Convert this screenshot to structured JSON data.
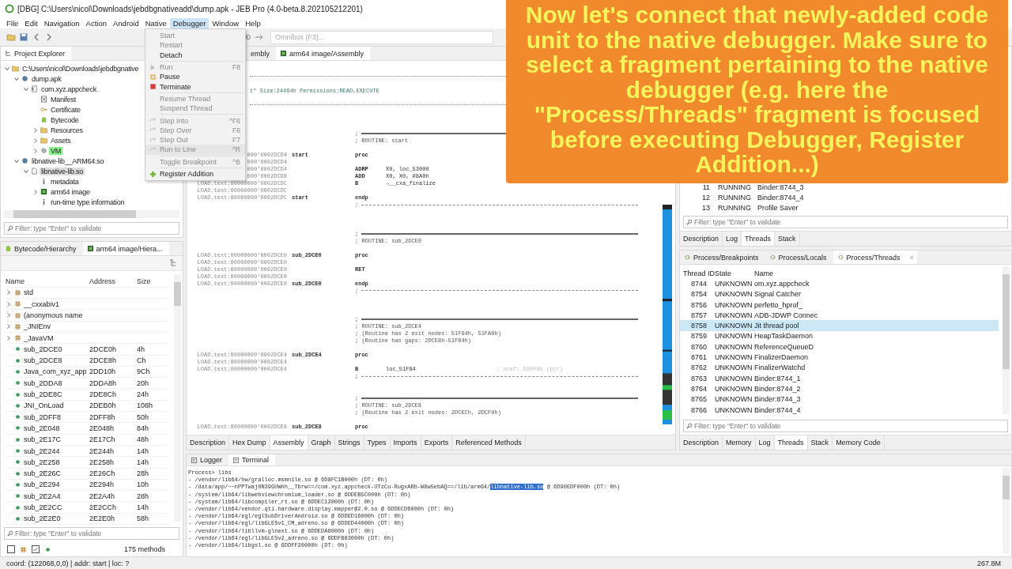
{
  "window": {
    "title": "[DBG] C:\\Users\\nicol\\Downloads\\jebdbgnativeadd\\dump.apk - JEB Pro (4.0-beta.8.202105212201)"
  },
  "menu_bar": [
    {
      "label": "File",
      "selected": false
    },
    {
      "label": "Edit",
      "selected": false
    },
    {
      "label": "Navigation",
      "selected": false
    },
    {
      "label": "Action",
      "selected": false
    },
    {
      "label": "Android",
      "selected": false
    },
    {
      "label": "Native",
      "selected": false
    },
    {
      "label": "Debugger",
      "selected": true
    },
    {
      "label": "Window",
      "selected": false
    },
    {
      "label": "Help",
      "selected": false
    }
  ],
  "toolbar": {
    "omnibox": {
      "placeholder": "Omnibox (F3)..."
    }
  },
  "debugger_menu": {
    "items": [
      {
        "kind": "plain",
        "label": "Start",
        "disabled": true,
        "selected": false
      },
      {
        "kind": "plain",
        "label": "Restart",
        "disabled": true,
        "selected": false
      },
      {
        "kind": "plain",
        "label": "Detach",
        "disabled": false,
        "selected": false
      },
      {
        "kind": "separator"
      },
      {
        "kind": "run",
        "label": "Run",
        "shortcut": "F8",
        "disabled": true,
        "selected": false
      },
      {
        "kind": "pause",
        "label": "Pause",
        "disabled": false,
        "selected": false
      },
      {
        "kind": "terminate",
        "label": "Terminate",
        "disabled": false,
        "selected": false
      },
      {
        "kind": "separator"
      },
      {
        "kind": "plain",
        "label": "Resume Thread",
        "disabled": true,
        "selected": false
      },
      {
        "kind": "plain",
        "label": "Suspend Thread",
        "disabled": true,
        "selected": false
      },
      {
        "kind": "separator"
      },
      {
        "kind": "step",
        "label": "Step Into",
        "shortcut": "^F6",
        "disabled": true,
        "selected": false
      },
      {
        "kind": "step",
        "label": "Step Over",
        "shortcut": "F6",
        "disabled": true,
        "selected": false
      },
      {
        "kind": "step",
        "label": "Step Out",
        "shortcut": "F7",
        "disabled": true,
        "selected": false
      },
      {
        "kind": "step",
        "label": "Run to Line",
        "shortcut": "^R",
        "disabled": true,
        "selected": true
      },
      {
        "kind": "separator"
      },
      {
        "kind": "plain",
        "label": "Toggle Breakpoint",
        "shortcut": "^B",
        "disabled": true,
        "selected": false
      },
      {
        "kind": "separator"
      },
      {
        "kind": "add",
        "label": "Register Addition",
        "disabled": false,
        "selected": false
      }
    ]
  },
  "project_explorer": {
    "tab": "Project Explorer",
    "tree": [
      {
        "label": "C:\\Users\\nicol\\Downloads\\jebdbgnative",
        "kind": "folder",
        "expanded": true,
        "selected": false,
        "highlighted": false,
        "children": [
          {
            "label": "dump.apk",
            "kind": "apk",
            "expanded": true,
            "selected": false,
            "highlighted": false,
            "children": [
              {
                "label": "com.xyz.appcheck",
                "kind": "package",
                "expanded": true,
                "selected": false,
                "highlighted": false,
                "children": [
                  {
                    "label": "Manifest",
                    "kind": "manifest",
                    "selected": false,
                    "highlighted": false
                  },
                  {
                    "label": "Certificate",
                    "kind": "certificate",
                    "selected": false,
                    "highlighted": false
                  },
                  {
                    "label": "Bytecode",
                    "kind": "bytecode",
                    "selected": false,
                    "highlighted": false
                  },
                  {
                    "label": "Resources",
                    "kind": "folder",
                    "expanded": false,
                    "selected": false,
                    "highlighted": false
                  },
                  {
                    "label": "Assets",
                    "kind": "folder",
                    "expanded": false,
                    "selected": false,
                    "highlighted": false
                  },
                  {
                    "label": "VM",
                    "kind": "gear",
                    "expanded": false,
                    "selected": false,
                    "highlighted": true
                  }
                ]
              }
            ]
          },
          {
            "label": "libnative-lib__ARM64.so",
            "kind": "apk",
            "expanded": true,
            "selected": false,
            "highlighted": false,
            "children": [
              {
                "label": "libnative-lib.so",
                "kind": "file",
                "expanded": true,
                "selected": true,
                "highlighted": false,
                "children": [
                  {
                    "label": "metadata",
                    "kind": "info",
                    "selected": false,
                    "highlighted": false
                  },
                  {
                    "label": "arm64 image",
                    "kind": "image",
                    "expanded": false,
                    "selected": false,
                    "highlighted": false
                  },
                  {
                    "label": "run-time type information",
                    "kind": "info",
                    "selected": false,
                    "highlighted": false
                  }
                ]
              }
            ]
          }
        ]
      }
    ],
    "filter": {
      "placeholder": "Filter: type \"Enter\" to validate"
    }
  },
  "hierarchy": {
    "tabs": [
      {
        "label": "Bytecode/Hierarchy",
        "kind": "bytecode",
        "selected": false
      },
      {
        "label": "arm64 image/Hiera...",
        "kind": "image",
        "selected": true
      }
    ],
    "columns": [
      "Name",
      "Address",
      "Size"
    ],
    "rows": [
      {
        "kind": "namespace",
        "name": "std",
        "expanded": false
      },
      {
        "kind": "namespace",
        "name": "__cxxabiv1",
        "expanded": false
      },
      {
        "kind": "namespace",
        "name": "(anonymous name",
        "expanded": false
      },
      {
        "kind": "namespace",
        "name": "_JNIEnv",
        "expanded": false
      },
      {
        "kind": "namespace",
        "name": "_JavaVM",
        "expanded": false
      },
      {
        "kind": "method",
        "name": "sub_2DCE0",
        "address": "2DCE0h",
        "size": "4h"
      },
      {
        "kind": "method",
        "name": "sub_2DCE8",
        "address": "2DCE8h",
        "size": "Ch"
      },
      {
        "kind": "method",
        "name": "Java_com_xyz_app",
        "address": "2DD10h",
        "size": "9Ch"
      },
      {
        "kind": "method",
        "name": "sub_2DDA8",
        "address": "2DDA8h",
        "size": "20h"
      },
      {
        "kind": "method",
        "name": "sub_2DE8C",
        "address": "2DE8Ch",
        "size": "24h"
      },
      {
        "kind": "method",
        "name": "JNI_OnLoad",
        "address": "2DEB0h",
        "size": "108h"
      },
      {
        "kind": "method",
        "name": "sub_2DFF8",
        "address": "2DFF8h",
        "size": "50h"
      },
      {
        "kind": "method",
        "name": "sub_2E048",
        "address": "2E048h",
        "size": "84h"
      },
      {
        "kind": "method",
        "name": "sub_2E17C",
        "address": "2E17Ch",
        "size": "48h"
      },
      {
        "kind": "method",
        "name": "sub_2E244",
        "address": "2E244h",
        "size": "14h"
      },
      {
        "kind": "method",
        "name": "sub_2E258",
        "address": "2E258h",
        "size": "14h"
      },
      {
        "kind": "method",
        "name": "sub_2E26C",
        "address": "2E26Ch",
        "size": "28h"
      },
      {
        "kind": "method",
        "name": "sub_2E294",
        "address": "2E294h",
        "size": "10h"
      },
      {
        "kind": "method",
        "name": "sub_2E2A4",
        "address": "2E2A4h",
        "size": "28h"
      },
      {
        "kind": "method",
        "name": "sub_2E2CC",
        "address": "2E2CCh",
        "size": "14h"
      },
      {
        "kind": "method",
        "name": "sub_2E2E0",
        "address": "2E2E0h",
        "size": "58h"
      }
    ],
    "filter": {
      "placeholder": "Filter: type \"Enter\" to validate"
    },
    "toggles": [
      {
        "kind": "namespace",
        "checked": false
      },
      {
        "kind": "method",
        "checked": true
      }
    ],
    "count": "175 methods"
  },
  "editor": {
    "tabs": [
      {
        "label": "embly",
        "selected": false
      },
      {
        "label": "arm64 image/Assembly",
        "selected": true
      }
    ],
    "lines": [
      {
        "kind": "dots"
      },
      {
        "kind": "blank"
      },
      {
        "kind": "header",
        "text": "t\" Size:24464h Permissions:READ,EXECUTE"
      },
      {
        "kind": "blank"
      },
      {
        "kind": "dots"
      },
      {
        "kind": "blank"
      },
      {
        "kind": "blank"
      },
      {
        "kind": "blank"
      },
      {
        "kind": "double",
        "text": ";"
      },
      {
        "kind": "comment",
        "text": "; ROUTINE: start"
      },
      {
        "kind": "blank"
      },
      {
        "kind": "code",
        "addr": "000'0002DCD4",
        "label": "start",
        "mnem": "proc"
      },
      {
        "kind": "code",
        "addr": "000'0002DCD4"
      },
      {
        "kind": "code",
        "addr": "000'0002DCD4",
        "mnem": "ADRP",
        "ops": "X0, loc_53000"
      },
      {
        "kind": "code",
        "addr": "000'0002DCD8",
        "mnem": "ADD",
        "ops": "X0, X0, #8A0h"
      },
      {
        "kind": "code",
        "addr": "LOAD.text:00000000'0002DCDC",
        "mnem": "B",
        "ops": "→__cxa_finalize"
      },
      {
        "kind": "code",
        "addr": "LOAD.text:00000000'0002DCDC"
      },
      {
        "kind": "code",
        "addr": "LOAD.text:00000000'0002DCDC",
        "label": "start",
        "mnem": "endp"
      },
      {
        "kind": "dash",
        "text": ";"
      },
      {
        "kind": "blank"
      },
      {
        "kind": "blank"
      },
      {
        "kind": "blank"
      },
      {
        "kind": "double",
        "text": ";"
      },
      {
        "kind": "comment",
        "text": "; ROUTINE: sub_2DCE0"
      },
      {
        "kind": "blank"
      },
      {
        "kind": "code",
        "addr": "LOAD.text:00000000'0002DCE0",
        "label": "sub_2DCE0",
        "mnem": "proc"
      },
      {
        "kind": "code",
        "addr": "LOAD.text:00000000'0002DCE0"
      },
      {
        "kind": "code",
        "addr": "LOAD.text:00000000'0002DCE0",
        "mnem": "RET"
      },
      {
        "kind": "code",
        "addr": "LOAD.text:00000000'0002DCE0"
      },
      {
        "kind": "code",
        "addr": "LOAD.text:00000000'0002DCE0",
        "label": "sub_2DCE0",
        "mnem": "endp"
      },
      {
        "kind": "dash",
        "text": ";"
      },
      {
        "kind": "blank"
      },
      {
        "kind": "blank"
      },
      {
        "kind": "blank"
      },
      {
        "kind": "double",
        "text": ";"
      },
      {
        "kind": "comment",
        "text": "; ROUTINE: sub_2DCE4"
      },
      {
        "kind": "comment",
        "text": "; (Routine has 2 exit nodes: 51F94h, 51FA0h)"
      },
      {
        "kind": "comment",
        "text": "; (Routine has gaps: 2DCE8h-51F84h)"
      },
      {
        "kind": "blank"
      },
      {
        "kind": "code",
        "addr": "LOAD.text:00000000'0002DCE4",
        "label": "sub_2DCE4",
        "mnem": "proc"
      },
      {
        "kind": "code",
        "addr": "LOAD.text:00000000'0002DCE4"
      },
      {
        "kind": "code",
        "addr": "LOAD.text:00000000'0002DCE4",
        "mnem": "B",
        "ops": "loc_51F84",
        "comment": "; xref: 560F0h (ptr)"
      },
      {
        "kind": "dash",
        "text": ";"
      },
      {
        "kind": "blank"
      },
      {
        "kind": "blank"
      },
      {
        "kind": "double",
        "text": ";"
      },
      {
        "kind": "comment",
        "text": "; ROUTINE: sub_2DCE8"
      },
      {
        "kind": "comment",
        "text": "; (Routine has 2 exit nodes: 2DCECh, 2DCF0h)"
      },
      {
        "kind": "blank"
      },
      {
        "kind": "code",
        "addr": "LOAD.text:00000000'0002DCE8",
        "label": "sub_2DCE8",
        "mnem": "proc"
      }
    ],
    "bottom_tabs": [
      {
        "label": "Description",
        "selected": false
      },
      {
        "label": "Hex Dump",
        "selected": false
      },
      {
        "label": "Assembly",
        "selected": true
      },
      {
        "label": "Graph",
        "selected": false
      },
      {
        "label": "Strings",
        "selected": false
      },
      {
        "label": "Types",
        "selected": false
      },
      {
        "label": "Imports",
        "selected": false
      },
      {
        "label": "Exports",
        "selected": false
      },
      {
        "label": "Referenced Methods",
        "selected": false
      }
    ]
  },
  "process_threads_top": {
    "rows": [
      {
        "id": "11",
        "state": "RUNNING",
        "name": "Binder:8744_3"
      },
      {
        "id": "12",
        "state": "RUNNING",
        "name": "Binder:8744_4"
      },
      {
        "id": "13",
        "state": "RUNNING",
        "name": "Profile Saver"
      }
    ],
    "filter": {
      "placeholder": "Filter: type \"Enter\" to validate"
    },
    "tabs": [
      {
        "label": "Description",
        "selected": false
      },
      {
        "label": "Log",
        "selected": false
      },
      {
        "label": "Threads",
        "selected": true
      },
      {
        "label": "Stack",
        "selected": false
      }
    ]
  },
  "process_views": {
    "tabs": [
      {
        "label": "Process/Breakpoints",
        "selected": false
      },
      {
        "label": "Process/Locals",
        "selected": false
      },
      {
        "label": "Process/Threads",
        "selected": true
      }
    ],
    "close_button": "×",
    "columns": [
      "Thread ID",
      "State",
      "Name"
    ],
    "rows": [
      {
        "id": "8744",
        "state": "UNKNOWN",
        "name": "om.xyz.appcheck",
        "selected": false
      },
      {
        "id": "8754",
        "state": "UNKNOWN",
        "name": "Signal Catcher",
        "selected": false
      },
      {
        "id": "8756",
        "state": "UNKNOWN",
        "name": "perfetto_hprof_",
        "selected": false
      },
      {
        "id": "8757",
        "state": "UNKNOWN",
        "name": "ADB-JDWP Connec",
        "selected": false
      },
      {
        "id": "8758",
        "state": "UNKNOWN",
        "name": "Jit thread pool",
        "selected": true
      },
      {
        "id": "8759",
        "state": "UNKNOWN",
        "name": "HeapTaskDaemon",
        "selected": false
      },
      {
        "id": "8760",
        "state": "UNKNOWN",
        "name": "ReferenceQueueD",
        "selected": false
      },
      {
        "id": "8761",
        "state": "UNKNOWN",
        "name": "FinalizerDaemon",
        "selected": false
      },
      {
        "id": "8762",
        "state": "UNKNOWN",
        "name": "FinalizerWatchd",
        "selected": false
      },
      {
        "id": "8763",
        "state": "UNKNOWN",
        "name": "Binder:8744_1",
        "selected": false
      },
      {
        "id": "8764",
        "state": "UNKNOWN",
        "name": "Binder:8744_2",
        "selected": false
      },
      {
        "id": "8765",
        "state": "UNKNOWN",
        "name": "Binder:8744_3",
        "selected": false
      },
      {
        "id": "8766",
        "state": "UNKNOWN",
        "name": "Binder:8744_4",
        "selected": false
      }
    ],
    "filter": {
      "placeholder": "Filter: type \"Enter\" to validate"
    },
    "bottom_tabs": [
      {
        "label": "Description",
        "selected": false
      },
      {
        "label": "Memory",
        "selected": false
      },
      {
        "label": "Log",
        "selected": false
      },
      {
        "label": "Threads",
        "selected": true
      },
      {
        "label": "Stack",
        "selected": false
      },
      {
        "label": "Memory Code",
        "selected": false
      }
    ]
  },
  "console": {
    "tabs": [
      {
        "label": "Logger",
        "selected": false
      },
      {
        "label": "Terminal",
        "selected": true
      }
    ],
    "lines": [
      {
        "text": "Process> libs"
      },
      {
        "text": "- /vendor/lib64/hw/gralloc.msmnile.so @ 6D8FC1B000h (DT: 0h)"
      },
      {
        "text": "- /data/app/~~nPPTwaj0N39GUWnh__Tbrw==/com.xyz.appcheck-UTzCu-RugxARb-W8w5ebAQ==/lib/arm64/",
        "selection": "libnative-lib.so",
        "after": " @ 6D90EDF000h (DT: 0h)"
      },
      {
        "text": "- /system/lib64/libwebviewchromium_loader.so @ 6DDEB5C000h (DT: 0h)"
      },
      {
        "text": "- /system/lib64/libcompiler_rt.so @ 6DDEC12000h (DT: 0h)"
      },
      {
        "text": "- /vendor/lib64/vendor.qti.hardware.display.mapper@2.0.so @ 6DDECD6000h (DT: 0h)"
      },
      {
        "text": "- /vendor/lib64/egl/eglSubDriverAndroid.so @ 6DDED16000h (DT: 0h)"
      },
      {
        "text": "- /vendor/lib64/egl/libGLESv1_CM_adreno.so @ 6DDED44000h (DT: 0h)"
      },
      {
        "text": "- /vendor/lib64/libllvm-glnext.so @ 6DDEDA8000h (DT: 0h)"
      },
      {
        "text": "- /vendor/lib64/egl/libGLESv2_adreno.so @ 6DDFB03000h (DT: 0h)"
      },
      {
        "text": "- /vendor/lib64/libgsl.so @ 6DDFF20000h (DT: 0h)"
      }
    ]
  },
  "status_bar": {
    "position": "coord: (122068,0,0) | addr: start | loc: ?",
    "memory": "267.8M"
  },
  "callout": {
    "text": "Now let's connect that newly-added code unit to the native debugger. Make sure to select a fragment pertaining to the native debugger (e.g. here the \"Process/Threads\" fragment is focused before executing Debugger, Register Addition...)"
  }
}
